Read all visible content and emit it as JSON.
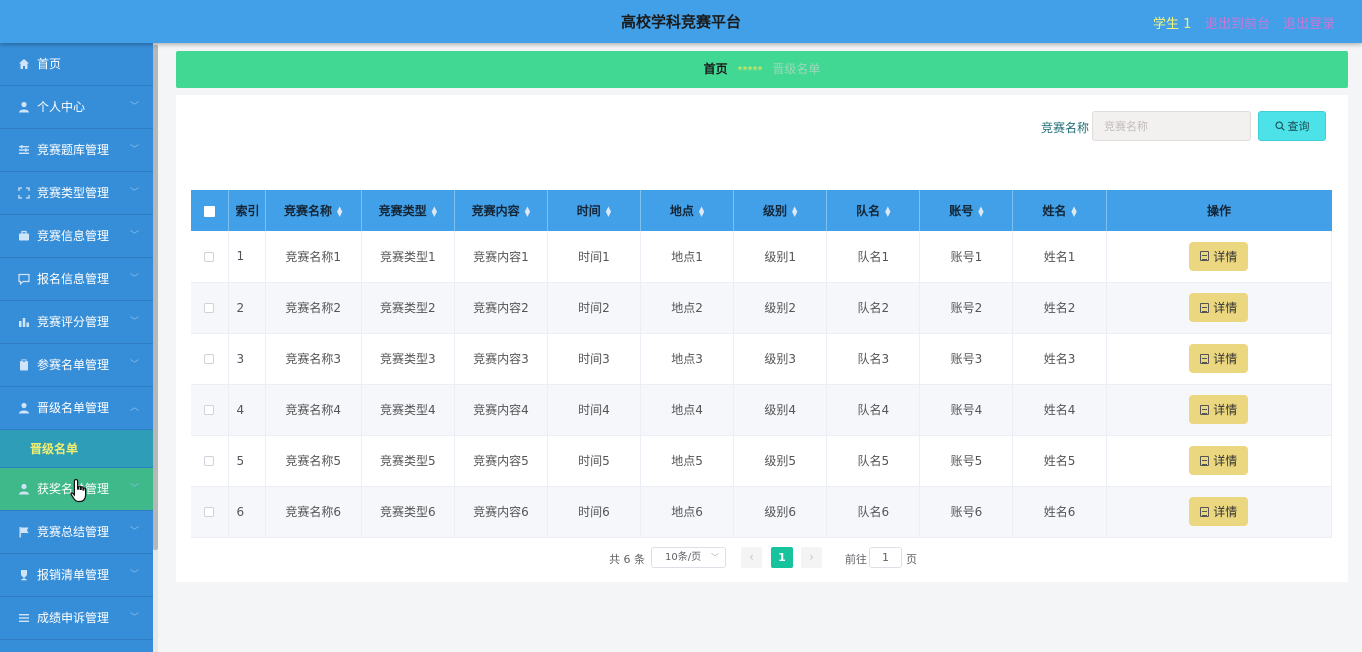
{
  "header": {
    "title": "高校学科竞赛平台",
    "user": "学生 1",
    "exit_front": "退出到前台",
    "logout": "退出登录"
  },
  "sidebar": {
    "items": [
      {
        "label": "首页",
        "icon": "home-icon"
      },
      {
        "label": "个人中心",
        "icon": "user-icon"
      },
      {
        "label": "竞赛题库管理",
        "icon": "sliders-icon"
      },
      {
        "label": "竞赛类型管理",
        "icon": "frame-icon"
      },
      {
        "label": "竞赛信息管理",
        "icon": "briefcase-icon"
      },
      {
        "label": "报名信息管理",
        "icon": "chat-icon"
      },
      {
        "label": "竞赛评分管理",
        "icon": "chart-icon"
      },
      {
        "label": "参赛名单管理",
        "icon": "clipboard-icon"
      },
      {
        "label": "晋级名单管理",
        "icon": "user-icon"
      },
      {
        "label": "获奖名单管理",
        "icon": "user-icon"
      },
      {
        "label": "竞赛总结管理",
        "icon": "flag-icon"
      },
      {
        "label": "报销清单管理",
        "icon": "trophy-icon"
      },
      {
        "label": "成绩申诉管理",
        "icon": "list-icon"
      }
    ],
    "submenu": {
      "label": "晋级名单"
    }
  },
  "breadcrumb": {
    "home": "首页",
    "separator": "*****",
    "current": "晋级名单"
  },
  "search": {
    "label": "竞赛名称",
    "placeholder": "竞赛名称",
    "button": "查询"
  },
  "table": {
    "columns": [
      "索引",
      "竞赛名称",
      "竞赛类型",
      "竞赛内容",
      "时间",
      "地点",
      "级别",
      "队名",
      "账号",
      "姓名",
      "操作"
    ],
    "rows": [
      {
        "idx": "1",
        "name": "竞赛名称1",
        "type": "竞赛类型1",
        "content": "竞赛内容1",
        "time": "时间1",
        "place": "地点1",
        "level": "级别1",
        "team": "队名1",
        "account": "账号1",
        "person": "姓名1"
      },
      {
        "idx": "2",
        "name": "竞赛名称2",
        "type": "竞赛类型2",
        "content": "竞赛内容2",
        "time": "时间2",
        "place": "地点2",
        "level": "级别2",
        "team": "队名2",
        "account": "账号2",
        "person": "姓名2"
      },
      {
        "idx": "3",
        "name": "竞赛名称3",
        "type": "竞赛类型3",
        "content": "竞赛内容3",
        "time": "时间3",
        "place": "地点3",
        "level": "级别3",
        "team": "队名3",
        "account": "账号3",
        "person": "姓名3"
      },
      {
        "idx": "4",
        "name": "竞赛名称4",
        "type": "竞赛类型4",
        "content": "竞赛内容4",
        "time": "时间4",
        "place": "地点4",
        "level": "级别4",
        "team": "队名4",
        "account": "账号4",
        "person": "姓名4"
      },
      {
        "idx": "5",
        "name": "竞赛名称5",
        "type": "竞赛类型5",
        "content": "竞赛内容5",
        "time": "时间5",
        "place": "地点5",
        "level": "级别5",
        "team": "队名5",
        "account": "账号5",
        "person": "姓名5"
      },
      {
        "idx": "6",
        "name": "竞赛名称6",
        "type": "竞赛类型6",
        "content": "竞赛内容6",
        "time": "时间6",
        "place": "地点6",
        "level": "级别6",
        "team": "队名6",
        "account": "账号6",
        "person": "姓名6"
      }
    ],
    "detail_label": "详情"
  },
  "pagination": {
    "total": "共 6 条",
    "page_size": "10条/页",
    "current_page": "1",
    "goto_label": "前往",
    "goto_value": "1",
    "page_suffix": "页"
  },
  "colors": {
    "header": "#42a0e8",
    "sidebar": "#378ed8",
    "breadcrumb": "#41d894",
    "search_button": "#4de1e8",
    "detail_button": "#ebd77f",
    "active_page": "#17c39c"
  }
}
